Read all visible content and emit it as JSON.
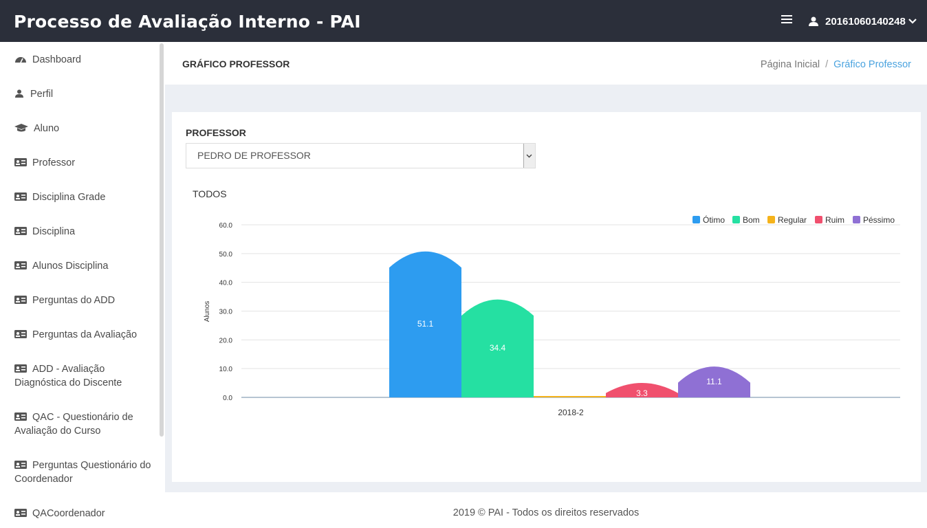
{
  "header": {
    "title": "Processo de Avaliação Interno - PAI",
    "username": "20161060140248"
  },
  "sidebar": {
    "items": [
      {
        "label": "Dashboard",
        "icon": "dashboard-icon"
      },
      {
        "label": "Perfil",
        "icon": "user-icon"
      },
      {
        "label": "Aluno",
        "icon": "graduation-cap-icon"
      },
      {
        "label": "Professor",
        "icon": "id-card-icon"
      },
      {
        "label": "Disciplina Grade",
        "icon": "id-card-icon"
      },
      {
        "label": "Disciplina",
        "icon": "id-card-icon"
      },
      {
        "label": "Alunos Disciplina",
        "icon": "id-card-icon"
      },
      {
        "label": "Perguntas do ADD",
        "icon": "id-card-icon"
      },
      {
        "label": "Perguntas da Avaliação",
        "icon": "id-card-icon"
      },
      {
        "label": "ADD - Avaliação Diagnóstica do Discente",
        "icon": "id-card-icon"
      },
      {
        "label": "QAC - Questionário de Avaliação do Curso",
        "icon": "id-card-icon"
      },
      {
        "label": "Perguntas Questionário do Coordenador",
        "icon": "id-card-icon"
      },
      {
        "label": "QACoordenador",
        "icon": "id-card-icon"
      }
    ]
  },
  "content_header": {
    "title": "GRÁFICO PROFESSOR",
    "breadcrumb": [
      "Página Inicial",
      "Gráfico Professor"
    ]
  },
  "form": {
    "professor_label": "PROFESSOR",
    "professor_selected": "PEDRO DE PROFESSOR"
  },
  "chart_title": "TODOS",
  "chart_data": {
    "type": "bar",
    "categories": [
      "2018-2"
    ],
    "series": [
      {
        "name": "Ótimo",
        "color": "#2d9cf0",
        "values": [
          51.1
        ]
      },
      {
        "name": "Bom",
        "color": "#25e0a2",
        "values": [
          34.4
        ]
      },
      {
        "name": "Regular",
        "color": "#f5b31b",
        "values": [
          0
        ]
      },
      {
        "name": "Ruim",
        "color": "#f0506e",
        "values": [
          3.3
        ]
      },
      {
        "name": "Péssimo",
        "color": "#8f70d4",
        "values": [
          11.1
        ]
      }
    ],
    "ylabel": "Alunos",
    "ylim": [
      0,
      60
    ],
    "yticks": [
      "0.0",
      "10.0",
      "20.0",
      "30.0",
      "40.0",
      "50.0",
      "60.0"
    ],
    "legend": "top-right",
    "grid": true
  },
  "footer": {
    "text": "2019 © PAI - Todos os direitos reservados"
  }
}
